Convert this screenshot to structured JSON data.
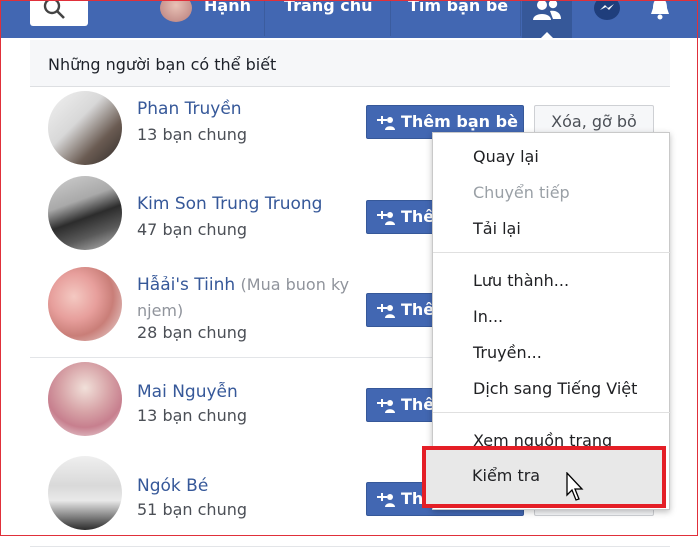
{
  "topbar": {
    "user_name": "Hạnh",
    "home": "Trang chủ",
    "find_friends": "Tìm bạn bè",
    "color": "#4267b2"
  },
  "section": {
    "title": "Những người bạn có thể biết"
  },
  "buttons": {
    "add_friend": "Thêm bạn bè",
    "remove": "Xóa, gỡ bỏ"
  },
  "people": [
    {
      "name": "Phan Truyền",
      "extra": "",
      "mutual": "13 bạn chung"
    },
    {
      "name": "Kim Son Trung Truong",
      "extra": "",
      "mutual": "47 bạn chung"
    },
    {
      "name": "Hẫải's Tiinh",
      "extra": "(Mua buon ky",
      "extra2": "njem)",
      "mutual": "28 bạn chung"
    },
    {
      "name": "Mai Nguyễn",
      "extra": "",
      "mutual": "13 bạn chung"
    },
    {
      "name": "Ngók Bé",
      "extra": "",
      "mutual": "51 bạn chung"
    }
  ],
  "context_menu": {
    "items": [
      {
        "label": "Quay lại"
      },
      {
        "label": "Chuyển tiếp"
      },
      {
        "label": "Tải lại"
      },
      {
        "label": "Lưu thành..."
      },
      {
        "label": "In..."
      },
      {
        "label": "Truyền..."
      },
      {
        "label": "Dịch sang Tiếng Việt"
      },
      {
        "label": "Xem nguồn trang"
      },
      {
        "label": "Kiểm tra"
      }
    ],
    "highlight_color": "#e41e26"
  }
}
